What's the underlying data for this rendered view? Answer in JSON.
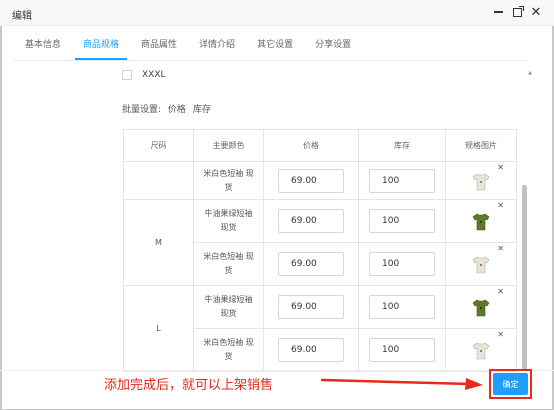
{
  "window": {
    "title": "编辑"
  },
  "tabs": [
    {
      "label": "基本信息",
      "active": false
    },
    {
      "label": "商品规格",
      "active": true
    },
    {
      "label": "商品属性",
      "active": false
    },
    {
      "label": "详情介绍",
      "active": false
    },
    {
      "label": "其它设置",
      "active": false
    },
    {
      "label": "分享设置",
      "active": false
    }
  ],
  "size_option": {
    "label": "XXXL",
    "checked": false
  },
  "batch": {
    "label": "批量设置:",
    "price_link": "价格",
    "stock_link": "库存"
  },
  "table": {
    "headers": [
      "尺码",
      "主要颜色",
      "价格",
      "库存",
      "规格图片"
    ],
    "rows": [
      {
        "size": "",
        "color": "米白色短袖 现货",
        "price": "69.00",
        "stock": "100",
        "image": "cream-shirt-icon"
      },
      {
        "size": "M",
        "color": "牛油果绿短袖 现货",
        "price": "69.00",
        "stock": "100",
        "image": "green-shirt-icon"
      },
      {
        "size": "",
        "color": "米白色短袖 现货",
        "price": "69.00",
        "stock": "100",
        "image": "cream-shirt-icon"
      },
      {
        "size": "L",
        "color": "牛油果绿短袖 现货",
        "price": "69.00",
        "stock": "100",
        "image": "green-shirt-icon"
      },
      {
        "size": "",
        "color": "米白色短袖 现货",
        "price": "69.00",
        "stock": "100",
        "image": "cream-shirt-icon"
      }
    ]
  },
  "annotation": {
    "text": "添加完成后，就可以上架销售"
  },
  "footer": {
    "confirm_label": "确定"
  },
  "colors": {
    "accent": "#1e9fff",
    "annotation_red": "#e8291d",
    "shirt_cream": "#e9e4d8",
    "shirt_green": "#5c7a2a"
  }
}
